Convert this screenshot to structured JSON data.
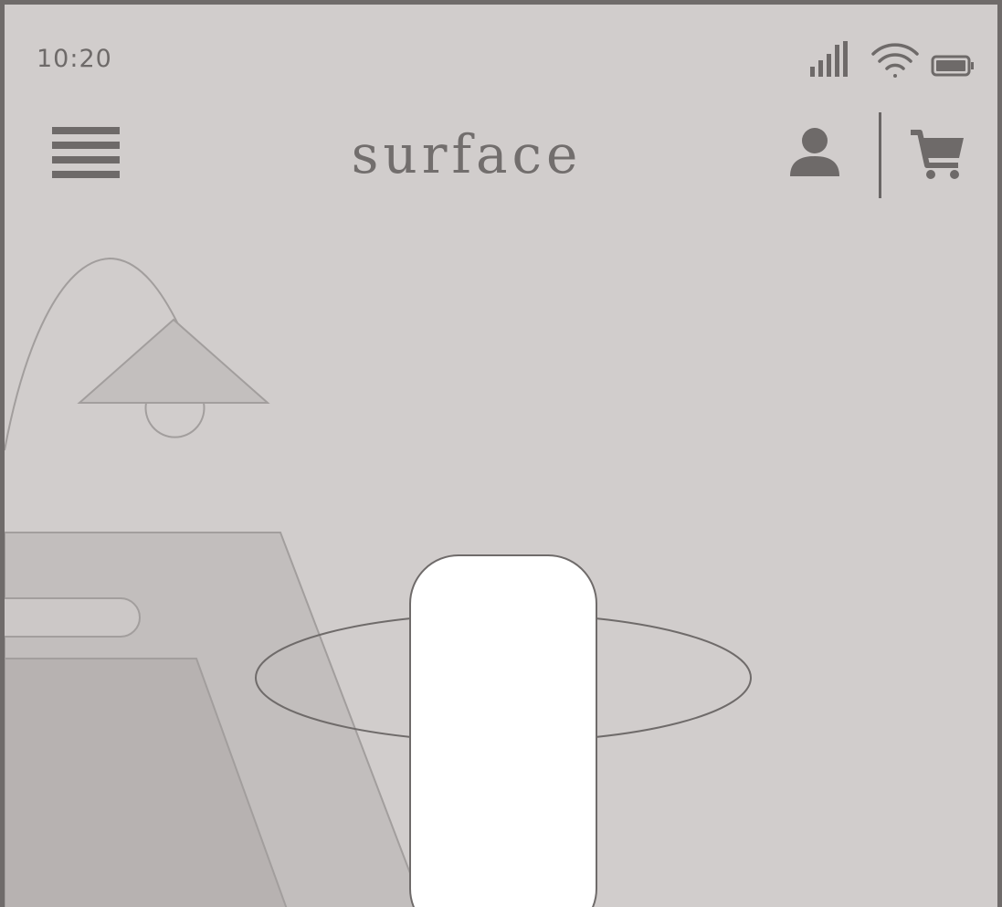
{
  "status_bar": {
    "time": "10:20",
    "icons": [
      "signal-icon",
      "wifi-icon",
      "battery-icon"
    ]
  },
  "nav": {
    "brand": "surface",
    "icons": [
      "menu-icon",
      "account-icon",
      "cart-icon"
    ]
  },
  "colors": {
    "background": "#d1cdcc",
    "frame": "#6f6b6a",
    "icon": "#6e6a69",
    "illustration_light": "#c2bebd",
    "illustration_dark": "#b7b2b1",
    "cta": "#ffffff"
  }
}
